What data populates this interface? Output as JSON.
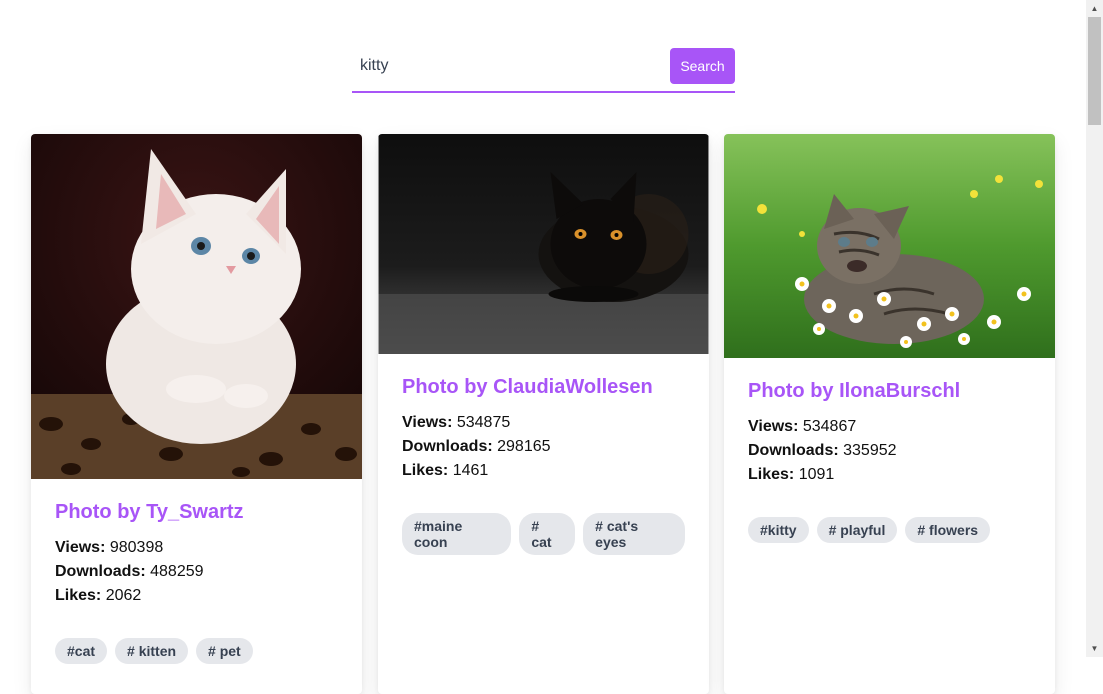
{
  "search": {
    "value": "kitty",
    "button_label": "Search"
  },
  "labels": {
    "views": "Views:",
    "downloads": "Downloads:",
    "likes": "Likes:"
  },
  "cards": [
    {
      "title": "Photo by Ty_Swartz",
      "views": "980398",
      "downloads": "488259",
      "likes": "2062",
      "tags": [
        "#cat",
        "# kitten",
        "# pet"
      ]
    },
    {
      "title": "Photo by ClaudiaWollesen",
      "views": "534875",
      "downloads": "298165",
      "likes": "1461",
      "tags": [
        "#maine coon",
        "# cat",
        "# cat's eyes"
      ]
    },
    {
      "title": "Photo by IlonaBurschl",
      "views": "534867",
      "downloads": "335952",
      "likes": "1091",
      "tags": [
        "#kitty",
        "# playful",
        "# flowers"
      ]
    }
  ],
  "colors": {
    "accent": "#a855f7",
    "tag_bg": "#e5e7eb"
  }
}
